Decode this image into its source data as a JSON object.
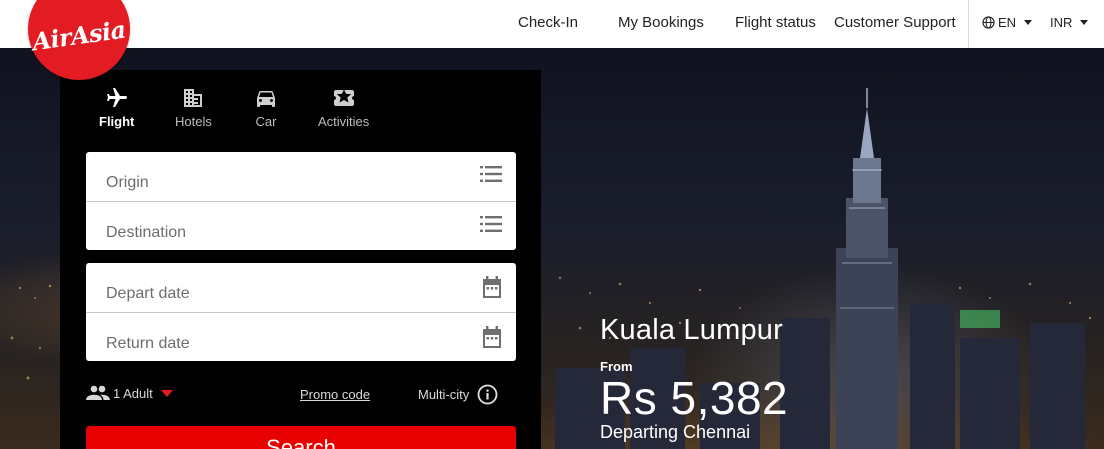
{
  "brand": {
    "logo_text": "AirAsia",
    "color": "#e31b23"
  },
  "nav": {
    "links": [
      "Check-In",
      "My Bookings",
      "Flight status",
      "Customer Support"
    ],
    "language": "EN",
    "currency": "INR"
  },
  "tabs": [
    {
      "label": "Flight",
      "icon": "plane-icon",
      "active": true
    },
    {
      "label": "Hotels",
      "icon": "building-icon",
      "active": false
    },
    {
      "label": "Car",
      "icon": "car-icon",
      "active": false
    },
    {
      "label": "Activities",
      "icon": "ticket-icon",
      "active": false
    }
  ],
  "form": {
    "origin_placeholder": "Origin",
    "destination_placeholder": "Destination",
    "depart_placeholder": "Depart date",
    "return_placeholder": "Return date",
    "passengers": "1 Adult",
    "promo_code": "Promo code",
    "multi_city": "Multi-city",
    "search_label": "Search",
    "accent": "#e80000"
  },
  "promo": {
    "destination": "Kuala Lumpur",
    "from_label": "From",
    "price": "Rs 5,382",
    "departing": "Departing Chennai"
  }
}
